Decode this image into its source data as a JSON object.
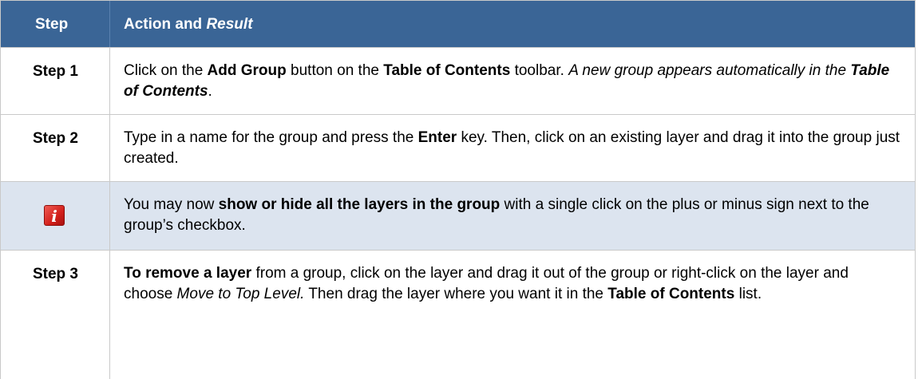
{
  "header": {
    "step_label": "Step",
    "action_label": "Action and ",
    "result_label": "Result"
  },
  "rows": [
    {
      "step": "Step 1",
      "parts": [
        {
          "t": "Click on the ",
          "s": ""
        },
        {
          "t": "Add Group",
          "s": "b"
        },
        {
          "t": " button on the ",
          "s": ""
        },
        {
          "t": "Table of Contents",
          "s": "b"
        },
        {
          "t": " toolbar. ",
          "s": ""
        },
        {
          "t": "A new group appears automatically in the ",
          "s": "i"
        },
        {
          "t": "Table of Contents",
          "s": "bi"
        },
        {
          "t": ".",
          "s": ""
        }
      ]
    },
    {
      "step": "Step 2",
      "parts": [
        {
          "t": "Type in a name for the group and press the ",
          "s": ""
        },
        {
          "t": "Enter",
          "s": "b"
        },
        {
          "t": " key. Then, click on an existing layer and drag it into the group just created.",
          "s": ""
        }
      ]
    },
    {
      "icon": "info-icon",
      "icon_color": "#d9231e",
      "parts": [
        {
          "t": "You may now ",
          "s": ""
        },
        {
          "t": "show or hide all the layers in the group",
          "s": "b"
        },
        {
          "t": " with a single click on the plus or minus sign next to the group’s checkbox.",
          "s": ""
        }
      ]
    },
    {
      "step": "Step 3",
      "parts": [
        {
          "t": "To remove a layer",
          "s": "b"
        },
        {
          "t": " from a group, click on the layer and drag it out of the group or right-click on the layer and choose ",
          "s": ""
        },
        {
          "t": "Move to Top Level.",
          "s": "i"
        },
        {
          "t": " Then drag the layer where you want it in the ",
          "s": ""
        },
        {
          "t": "Table of Contents",
          "s": "b"
        },
        {
          "t": " list.",
          "s": ""
        }
      ]
    }
  ],
  "colors": {
    "header_bg": "#3a6596",
    "note_bg": "#dce4ef",
    "border": "#c9c9c9"
  }
}
